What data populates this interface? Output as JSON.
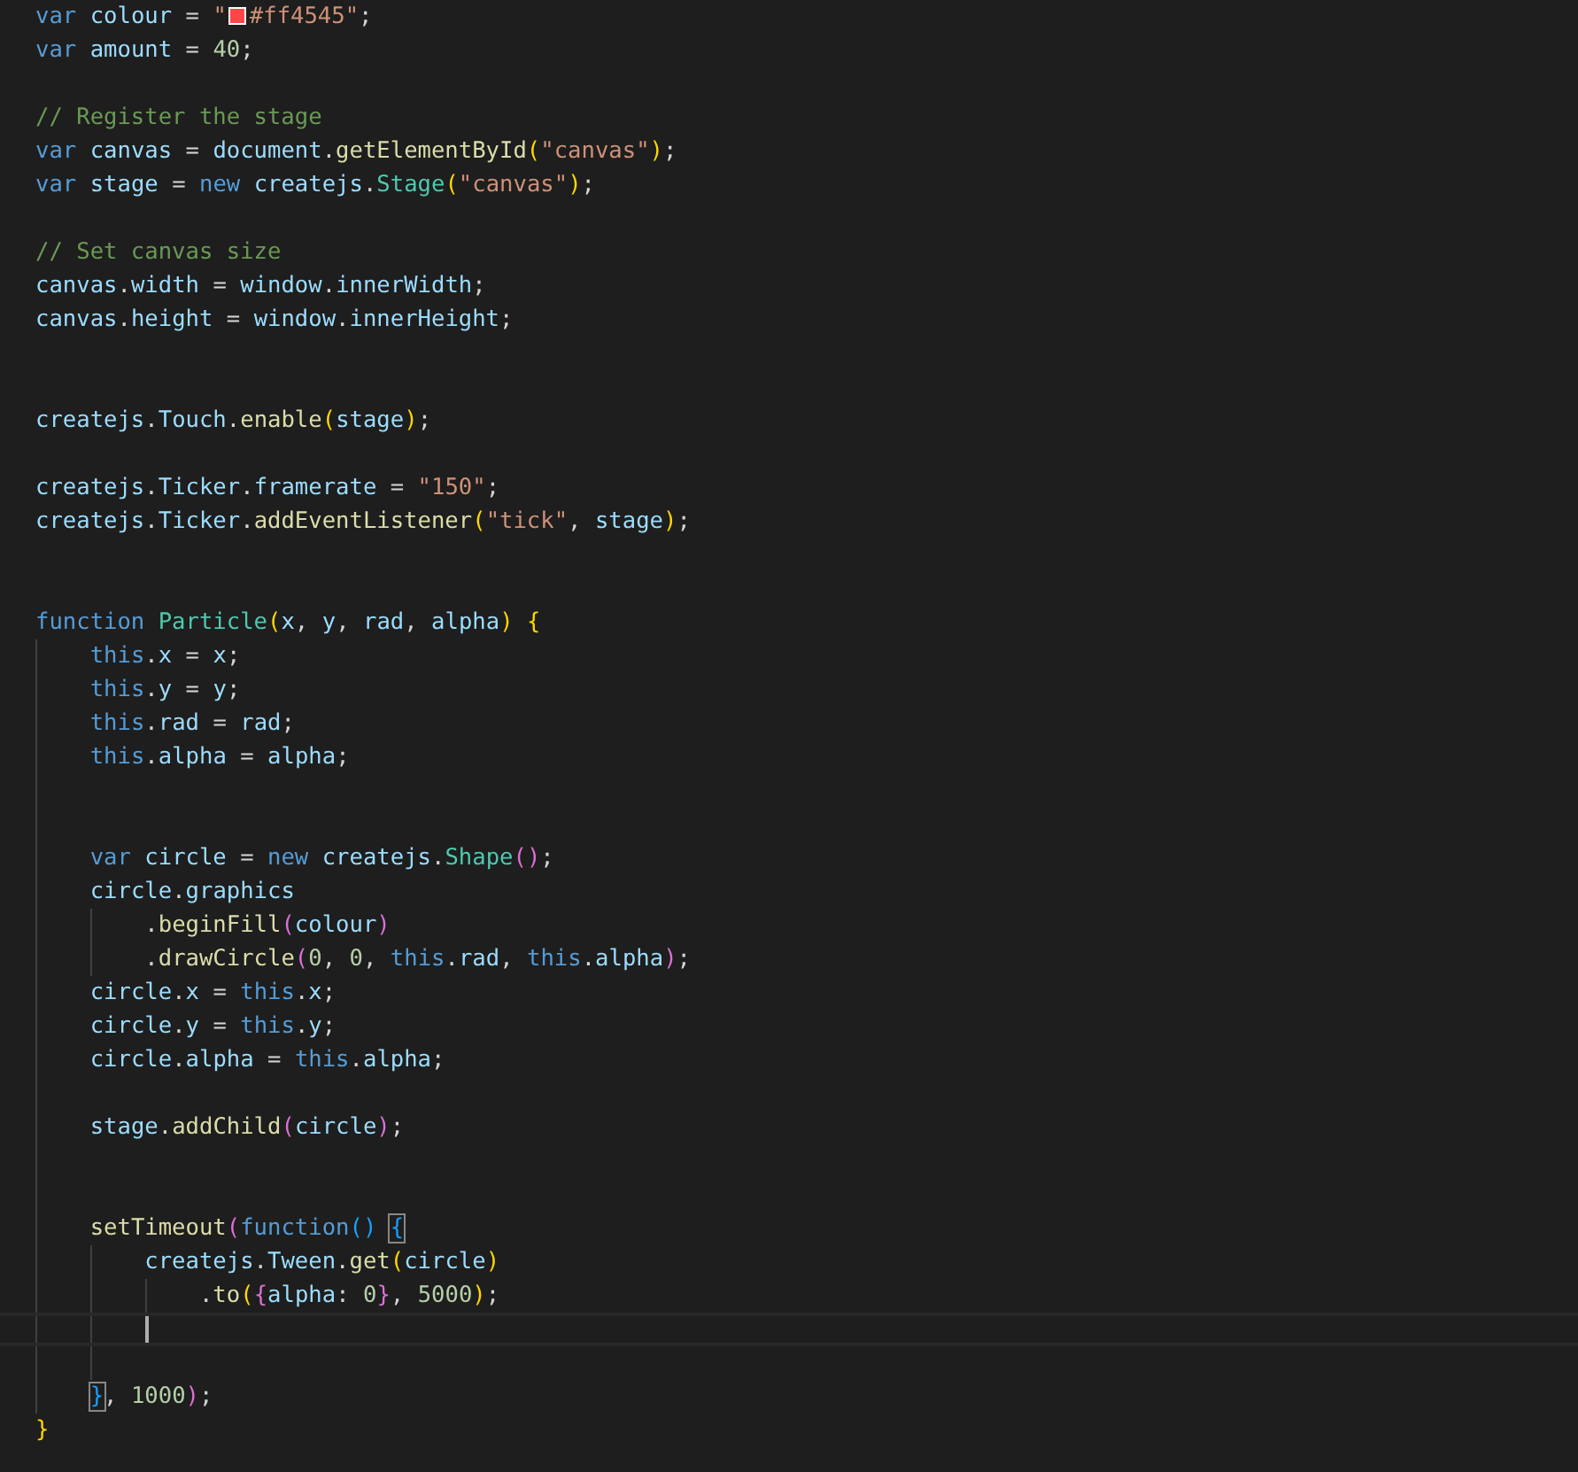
{
  "lines": [
    {
      "kind": "code",
      "tokens": [
        {
          "text": "var ",
          "kind": "kw"
        },
        {
          "text": "colour",
          "kind": "var"
        },
        {
          "text": " = ",
          "kind": "op"
        },
        {
          "text": "\"",
          "kind": "str"
        },
        {
          "kind": "swatch",
          "color": "#ff4545"
        },
        {
          "text": "#ff4545\"",
          "kind": "str"
        },
        {
          "text": ";",
          "kind": "op"
        }
      ]
    },
    {
      "kind": "code",
      "tokens": [
        {
          "text": "var ",
          "kind": "kw"
        },
        {
          "text": "amount",
          "kind": "var"
        },
        {
          "text": " = ",
          "kind": "op"
        },
        {
          "text": "40",
          "kind": "num"
        },
        {
          "text": ";",
          "kind": "op"
        }
      ]
    },
    {
      "kind": "blank"
    },
    {
      "kind": "code",
      "tokens": [
        {
          "text": "// Register the stage",
          "kind": "cmt"
        }
      ]
    },
    {
      "kind": "code",
      "tokens": [
        {
          "text": "var ",
          "kind": "kw"
        },
        {
          "text": "canvas",
          "kind": "var"
        },
        {
          "text": " = ",
          "kind": "op"
        },
        {
          "text": "document",
          "kind": "var"
        },
        {
          "text": ".",
          "kind": "op"
        },
        {
          "text": "getElementById",
          "kind": "fn"
        },
        {
          "text": "(",
          "kind": "br1"
        },
        {
          "text": "\"canvas\"",
          "kind": "str"
        },
        {
          "text": ")",
          "kind": "br1"
        },
        {
          "text": ";",
          "kind": "op"
        }
      ]
    },
    {
      "kind": "code",
      "tokens": [
        {
          "text": "var ",
          "kind": "kw"
        },
        {
          "text": "stage",
          "kind": "var"
        },
        {
          "text": " = ",
          "kind": "op"
        },
        {
          "text": "new ",
          "kind": "kw"
        },
        {
          "text": "createjs",
          "kind": "var"
        },
        {
          "text": ".",
          "kind": "op"
        },
        {
          "text": "Stage",
          "kind": "type"
        },
        {
          "text": "(",
          "kind": "br1"
        },
        {
          "text": "\"canvas\"",
          "kind": "str"
        },
        {
          "text": ")",
          "kind": "br1"
        },
        {
          "text": ";",
          "kind": "op"
        }
      ]
    },
    {
      "kind": "blank"
    },
    {
      "kind": "code",
      "tokens": [
        {
          "text": "// Set canvas size",
          "kind": "cmt"
        }
      ]
    },
    {
      "kind": "code",
      "tokens": [
        {
          "text": "canvas",
          "kind": "var"
        },
        {
          "text": ".",
          "kind": "op"
        },
        {
          "text": "width",
          "kind": "var"
        },
        {
          "text": " = ",
          "kind": "op"
        },
        {
          "text": "window",
          "kind": "var"
        },
        {
          "text": ".",
          "kind": "op"
        },
        {
          "text": "innerWidth",
          "kind": "var"
        },
        {
          "text": ";",
          "kind": "op"
        }
      ]
    },
    {
      "kind": "code",
      "tokens": [
        {
          "text": "canvas",
          "kind": "var"
        },
        {
          "text": ".",
          "kind": "op"
        },
        {
          "text": "height",
          "kind": "var"
        },
        {
          "text": " = ",
          "kind": "op"
        },
        {
          "text": "window",
          "kind": "var"
        },
        {
          "text": ".",
          "kind": "op"
        },
        {
          "text": "innerHeight",
          "kind": "var"
        },
        {
          "text": ";",
          "kind": "op"
        }
      ]
    },
    {
      "kind": "blank"
    },
    {
      "kind": "blank"
    },
    {
      "kind": "code",
      "tokens": [
        {
          "text": "createjs",
          "kind": "var"
        },
        {
          "text": ".",
          "kind": "op"
        },
        {
          "text": "Touch",
          "kind": "var"
        },
        {
          "text": ".",
          "kind": "op"
        },
        {
          "text": "enable",
          "kind": "fn"
        },
        {
          "text": "(",
          "kind": "br1"
        },
        {
          "text": "stage",
          "kind": "var"
        },
        {
          "text": ")",
          "kind": "br1"
        },
        {
          "text": ";",
          "kind": "op"
        }
      ]
    },
    {
      "kind": "blank"
    },
    {
      "kind": "code",
      "tokens": [
        {
          "text": "createjs",
          "kind": "var"
        },
        {
          "text": ".",
          "kind": "op"
        },
        {
          "text": "Ticker",
          "kind": "var"
        },
        {
          "text": ".",
          "kind": "op"
        },
        {
          "text": "framerate",
          "kind": "var"
        },
        {
          "text": " = ",
          "kind": "op"
        },
        {
          "text": "\"150\"",
          "kind": "str"
        },
        {
          "text": ";",
          "kind": "op"
        }
      ]
    },
    {
      "kind": "code",
      "tokens": [
        {
          "text": "createjs",
          "kind": "var"
        },
        {
          "text": ".",
          "kind": "op"
        },
        {
          "text": "Ticker",
          "kind": "var"
        },
        {
          "text": ".",
          "kind": "op"
        },
        {
          "text": "addEventListener",
          "kind": "fn"
        },
        {
          "text": "(",
          "kind": "br1"
        },
        {
          "text": "\"tick\"",
          "kind": "str"
        },
        {
          "text": ", ",
          "kind": "op"
        },
        {
          "text": "stage",
          "kind": "var"
        },
        {
          "text": ")",
          "kind": "br1"
        },
        {
          "text": ";",
          "kind": "op"
        }
      ]
    },
    {
      "kind": "blank"
    },
    {
      "kind": "blank"
    },
    {
      "kind": "code",
      "tokens": [
        {
          "text": "function ",
          "kind": "kw"
        },
        {
          "text": "Particle",
          "kind": "type"
        },
        {
          "text": "(",
          "kind": "br1"
        },
        {
          "text": "x",
          "kind": "var"
        },
        {
          "text": ", ",
          "kind": "op"
        },
        {
          "text": "y",
          "kind": "var"
        },
        {
          "text": ", ",
          "kind": "op"
        },
        {
          "text": "rad",
          "kind": "var"
        },
        {
          "text": ", ",
          "kind": "op"
        },
        {
          "text": "alpha",
          "kind": "var"
        },
        {
          "text": ") {",
          "kind": "br1"
        }
      ],
      "children": [
        {
          "kind": "code",
          "tokens": [
            {
              "text": "this",
              "kind": "kw"
            },
            {
              "text": ".",
              "kind": "op"
            },
            {
              "text": "x",
              "kind": "var"
            },
            {
              "text": " = ",
              "kind": "op"
            },
            {
              "text": "x",
              "kind": "var"
            },
            {
              "text": ";",
              "kind": "op"
            }
          ]
        },
        {
          "kind": "code",
          "tokens": [
            {
              "text": "this",
              "kind": "kw"
            },
            {
              "text": ".",
              "kind": "op"
            },
            {
              "text": "y",
              "kind": "var"
            },
            {
              "text": " = ",
              "kind": "op"
            },
            {
              "text": "y",
              "kind": "var"
            },
            {
              "text": ";",
              "kind": "op"
            }
          ]
        },
        {
          "kind": "code",
          "tokens": [
            {
              "text": "this",
              "kind": "kw"
            },
            {
              "text": ".",
              "kind": "op"
            },
            {
              "text": "rad",
              "kind": "var"
            },
            {
              "text": " = ",
              "kind": "op"
            },
            {
              "text": "rad",
              "kind": "var"
            },
            {
              "text": ";",
              "kind": "op"
            }
          ]
        },
        {
          "kind": "code",
          "tokens": [
            {
              "text": "this",
              "kind": "kw"
            },
            {
              "text": ".",
              "kind": "op"
            },
            {
              "text": "alpha",
              "kind": "var"
            },
            {
              "text": " = ",
              "kind": "op"
            },
            {
              "text": "alpha",
              "kind": "var"
            },
            {
              "text": ";",
              "kind": "op"
            }
          ]
        },
        {
          "kind": "blank"
        },
        {
          "kind": "blank"
        },
        {
          "kind": "code",
          "tokens": [
            {
              "text": "var ",
              "kind": "kw"
            },
            {
              "text": "circle",
              "kind": "var"
            },
            {
              "text": " = ",
              "kind": "op"
            },
            {
              "text": "new ",
              "kind": "kw"
            },
            {
              "text": "createjs",
              "kind": "var"
            },
            {
              "text": ".",
              "kind": "op"
            },
            {
              "text": "Shape",
              "kind": "type"
            },
            {
              "text": "()",
              "kind": "br2"
            },
            {
              "text": ";",
              "kind": "op"
            }
          ]
        },
        {
          "kind": "code",
          "tokens": [
            {
              "text": "circle",
              "kind": "var"
            },
            {
              "text": ".",
              "kind": "op"
            },
            {
              "text": "graphics",
              "kind": "var"
            }
          ],
          "children": [
            {
              "kind": "code",
              "tokens": [
                {
                  "text": ".",
                  "kind": "op"
                },
                {
                  "text": "beginFill",
                  "kind": "fn"
                },
                {
                  "text": "(",
                  "kind": "br2"
                },
                {
                  "text": "colour",
                  "kind": "var"
                },
                {
                  "text": ")",
                  "kind": "br2"
                }
              ]
            },
            {
              "kind": "code",
              "tokens": [
                {
                  "text": ".",
                  "kind": "op"
                },
                {
                  "text": "drawCircle",
                  "kind": "fn"
                },
                {
                  "text": "(",
                  "kind": "br2"
                },
                {
                  "text": "0",
                  "kind": "num"
                },
                {
                  "text": ", ",
                  "kind": "op"
                },
                {
                  "text": "0",
                  "kind": "num"
                },
                {
                  "text": ", ",
                  "kind": "op"
                },
                {
                  "text": "this",
                  "kind": "kw"
                },
                {
                  "text": ".",
                  "kind": "op"
                },
                {
                  "text": "rad",
                  "kind": "var"
                },
                {
                  "text": ", ",
                  "kind": "op"
                },
                {
                  "text": "this",
                  "kind": "kw"
                },
                {
                  "text": ".",
                  "kind": "op"
                },
                {
                  "text": "alpha",
                  "kind": "var"
                },
                {
                  "text": ")",
                  "kind": "br2"
                },
                {
                  "text": ";",
                  "kind": "op"
                }
              ]
            }
          ]
        },
        {
          "kind": "code",
          "tokens": [
            {
              "text": "circle",
              "kind": "var"
            },
            {
              "text": ".",
              "kind": "op"
            },
            {
              "text": "x",
              "kind": "var"
            },
            {
              "text": " = ",
              "kind": "op"
            },
            {
              "text": "this",
              "kind": "kw"
            },
            {
              "text": ".",
              "kind": "op"
            },
            {
              "text": "x",
              "kind": "var"
            },
            {
              "text": ";",
              "kind": "op"
            }
          ]
        },
        {
          "kind": "code",
          "tokens": [
            {
              "text": "circle",
              "kind": "var"
            },
            {
              "text": ".",
              "kind": "op"
            },
            {
              "text": "y",
              "kind": "var"
            },
            {
              "text": " = ",
              "kind": "op"
            },
            {
              "text": "this",
              "kind": "kw"
            },
            {
              "text": ".",
              "kind": "op"
            },
            {
              "text": "y",
              "kind": "var"
            },
            {
              "text": ";",
              "kind": "op"
            }
          ]
        },
        {
          "kind": "code",
          "tokens": [
            {
              "text": "circle",
              "kind": "var"
            },
            {
              "text": ".",
              "kind": "op"
            },
            {
              "text": "alpha",
              "kind": "var"
            },
            {
              "text": " = ",
              "kind": "op"
            },
            {
              "text": "this",
              "kind": "kw"
            },
            {
              "text": ".",
              "kind": "op"
            },
            {
              "text": "alpha",
              "kind": "var"
            },
            {
              "text": ";",
              "kind": "op"
            }
          ]
        },
        {
          "kind": "blank"
        },
        {
          "kind": "code",
          "tokens": [
            {
              "text": "stage",
              "kind": "var"
            },
            {
              "text": ".",
              "kind": "op"
            },
            {
              "text": "addChild",
              "kind": "fn"
            },
            {
              "text": "(",
              "kind": "br2"
            },
            {
              "text": "circle",
              "kind": "var"
            },
            {
              "text": ")",
              "kind": "br2"
            },
            {
              "text": ";",
              "kind": "op"
            }
          ]
        },
        {
          "kind": "blank"
        },
        {
          "kind": "blank"
        },
        {
          "kind": "code",
          "tokens": [
            {
              "text": "setTimeout",
              "kind": "fn"
            },
            {
              "text": "(",
              "kind": "br2"
            },
            {
              "text": "function",
              "kind": "kw"
            },
            {
              "text": "() ",
              "kind": "br3"
            },
            {
              "text": "{",
              "kind": "br3",
              "matched": true
            }
          ],
          "children": [
            {
              "kind": "code",
              "tokens": [
                {
                  "text": "createjs",
                  "kind": "var"
                },
                {
                  "text": ".",
                  "kind": "op"
                },
                {
                  "text": "Tween",
                  "kind": "var"
                },
                {
                  "text": ".",
                  "kind": "op"
                },
                {
                  "text": "get",
                  "kind": "fn"
                },
                {
                  "text": "(",
                  "kind": "br1"
                },
                {
                  "text": "circle",
                  "kind": "var"
                },
                {
                  "text": ")",
                  "kind": "br1"
                }
              ],
              "children": [
                {
                  "kind": "code",
                  "tokens": [
                    {
                      "text": ".",
                      "kind": "op"
                    },
                    {
                      "text": "to",
                      "kind": "fn"
                    },
                    {
                      "text": "(",
                      "kind": "br1"
                    },
                    {
                      "text": "{",
                      "kind": "br2"
                    },
                    {
                      "text": "alpha",
                      "kind": "var"
                    },
                    {
                      "text": ": ",
                      "kind": "op"
                    },
                    {
                      "text": "0",
                      "kind": "num"
                    },
                    {
                      "text": "}",
                      "kind": "br2"
                    },
                    {
                      "text": ", ",
                      "kind": "op"
                    },
                    {
                      "text": "5000",
                      "kind": "num"
                    },
                    {
                      "text": ")",
                      "kind": "br1"
                    },
                    {
                      "text": ";",
                      "kind": "op"
                    }
                  ]
                }
              ]
            },
            {
              "kind": "blank",
              "cursor": true
            },
            {
              "kind": "blank"
            }
          ]
        },
        {
          "kind": "code",
          "tokens": [
            {
              "text": "}",
              "kind": "br3",
              "matched": true
            },
            {
              "text": ", ",
              "kind": "op"
            },
            {
              "text": "1000",
              "kind": "num"
            },
            {
              "text": ")",
              "kind": "br2"
            },
            {
              "text": ";",
              "kind": "op"
            }
          ]
        }
      ]
    },
    {
      "kind": "code",
      "tokens": [
        {
          "text": "}",
          "kind": "br1"
        }
      ]
    }
  ]
}
